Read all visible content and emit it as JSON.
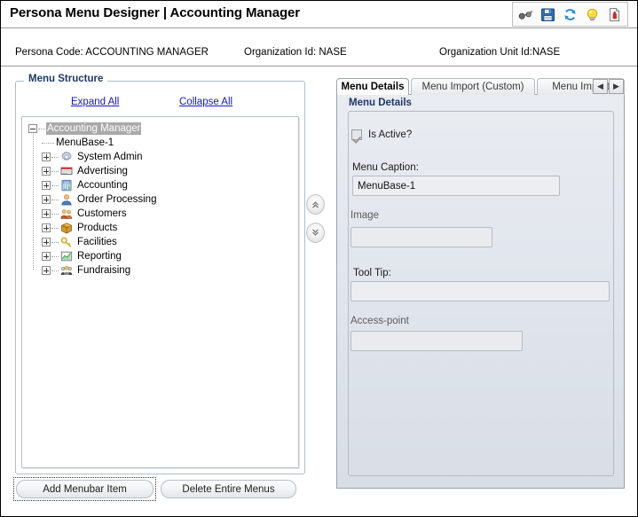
{
  "window": {
    "title": "Persona Menu Designer | Accounting Manager"
  },
  "toolbar": {
    "icons": [
      {
        "name": "binoculars-icon",
        "label": "View"
      },
      {
        "name": "save-icon",
        "label": "Save"
      },
      {
        "name": "refresh-icon",
        "label": "Refresh"
      },
      {
        "name": "lightbulb-icon",
        "label": "Hint"
      },
      {
        "name": "report-icon",
        "label": "Report"
      }
    ]
  },
  "info": {
    "persona_code": "Persona Code: ACCOUNTING MANAGER",
    "organization_id": "Organization Id: NASE",
    "organization_unit_id": "Organization Unit Id:NASE"
  },
  "menu_structure": {
    "legend": "Menu Structure",
    "expand_all": "Expand All",
    "collapse_all": "Collapse All",
    "tree": [
      {
        "label": "Accounting Manager",
        "expander": "minus",
        "icon": "none",
        "selected": true,
        "level": 0
      },
      {
        "label": "MenuBase-1",
        "expander": "none",
        "icon": "none",
        "selected": false,
        "level": 1
      },
      {
        "label": "System Admin",
        "expander": "plus",
        "icon": "gear-icon",
        "selected": false,
        "level": 1
      },
      {
        "label": "Advertising",
        "expander": "plus",
        "icon": "billboard-icon",
        "selected": false,
        "level": 1
      },
      {
        "label": "Accounting",
        "expander": "plus",
        "icon": "calculator-icon",
        "selected": false,
        "level": 1
      },
      {
        "label": "Order Processing",
        "expander": "plus",
        "icon": "person-icon",
        "selected": false,
        "level": 1
      },
      {
        "label": "Customers",
        "expander": "plus",
        "icon": "people-icon",
        "selected": false,
        "level": 1
      },
      {
        "label": "Products",
        "expander": "plus",
        "icon": "box-icon",
        "selected": false,
        "level": 1
      },
      {
        "label": "Facilities",
        "expander": "plus",
        "icon": "key-icon",
        "selected": false,
        "level": 1
      },
      {
        "label": "Reporting",
        "expander": "plus",
        "icon": "chart-icon",
        "selected": false,
        "level": 1
      },
      {
        "label": "Fundraising",
        "expander": "plus",
        "icon": "group-icon",
        "selected": false,
        "level": 1
      }
    ],
    "reorder": {
      "move_up": "move-up",
      "move_down": "move-down"
    },
    "buttons": {
      "add_menubar_item": "Add Menubar Item",
      "delete_entire_menus": "Delete Entire Menus"
    }
  },
  "tabs": [
    {
      "label": "Menu Details",
      "active": true
    },
    {
      "label": "Menu Import (Custom)",
      "active": false
    },
    {
      "label": "Menu Import",
      "active": false
    }
  ],
  "tab_nav": {
    "prev": "◀",
    "next": "▶"
  },
  "details": {
    "legend": "Menu Details",
    "is_active_label": "Is Active?",
    "is_active_checked": true,
    "menu_caption_label": "Menu Caption:",
    "menu_caption_value": "MenuBase-1",
    "image_label": "Image",
    "image_value": "",
    "tooltip_label": "Tool Tip:",
    "tooltip_value": "",
    "access_point_label": "Access-point",
    "access_point_value": ""
  },
  "colors": {
    "link": "#1515cd",
    "legend": "#1f3864",
    "selection": "#a9a9a9",
    "panel_bg": "#e3e7ee",
    "border": "#b4bcc6"
  }
}
